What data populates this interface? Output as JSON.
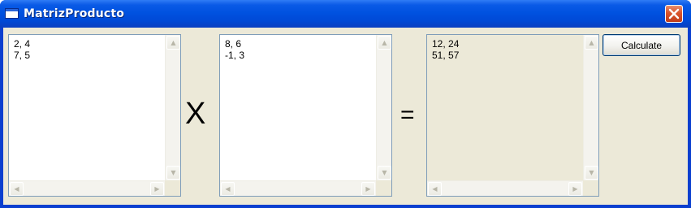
{
  "window": {
    "title": "MatrizProducto",
    "close_glyph": "✕"
  },
  "matrix_a": {
    "lines": [
      "2, 4",
      "7, 5"
    ]
  },
  "operator_multiply": "X",
  "matrix_b": {
    "lines": [
      "8, 6",
      "-1, 3"
    ]
  },
  "operator_equals": "=",
  "result": {
    "lines": [
      "12, 24",
      "51, 57"
    ]
  },
  "calculate_button": {
    "label": "Calculate"
  },
  "scroll": {
    "up": "▲",
    "down": "▼",
    "left": "◀",
    "right": "▶"
  },
  "colors": {
    "titlebar": "#0052e0",
    "client": "#ece9d8",
    "close_button": "#d9532b",
    "textbox_border": "#7f9db9"
  }
}
